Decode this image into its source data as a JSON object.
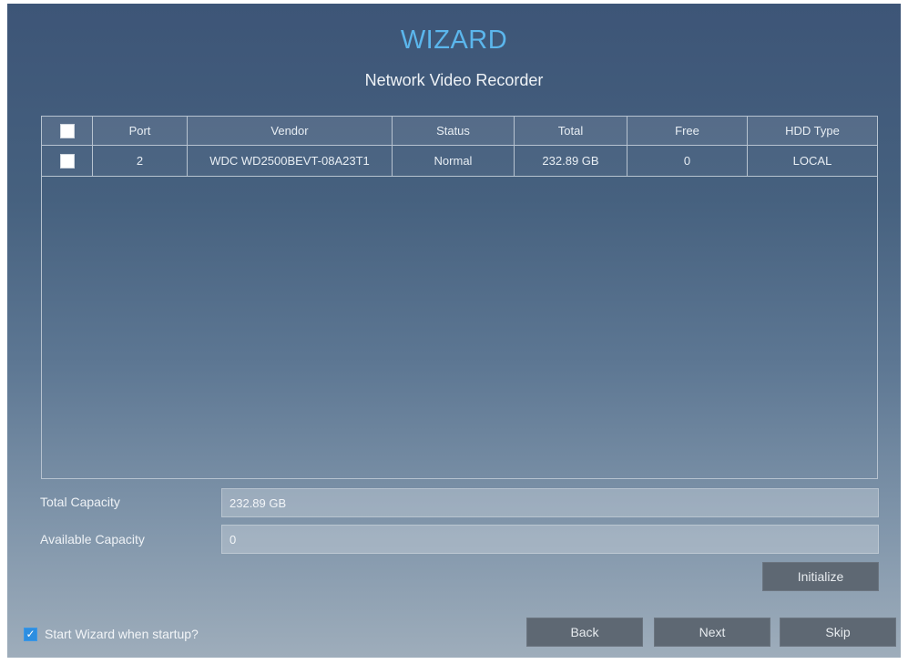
{
  "header": {
    "title": "WIZARD",
    "subtitle": "Network Video Recorder"
  },
  "table": {
    "columns": [
      "Port",
      "Vendor",
      "Status",
      "Total",
      "Free",
      "HDD Type"
    ],
    "rows": [
      {
        "port": "2",
        "vendor": "WDC WD2500BEVT-08A23T1",
        "status": "Normal",
        "total": "232.89 GB",
        "free": "0",
        "hdd_type": "LOCAL"
      }
    ]
  },
  "capacity": {
    "total_label": "Total Capacity",
    "total_value": "232.89 GB",
    "available_label": "Available Capacity",
    "available_value": "0"
  },
  "buttons": {
    "initialize": "Initialize",
    "back": "Back",
    "next": "Next",
    "skip": "Skip"
  },
  "startup": {
    "label": "Start Wizard when startup?",
    "checked": true
  },
  "colors": {
    "title": "#5bb6ec",
    "checkbox_checked": "#2d8ee0",
    "button": "#5e6873"
  }
}
